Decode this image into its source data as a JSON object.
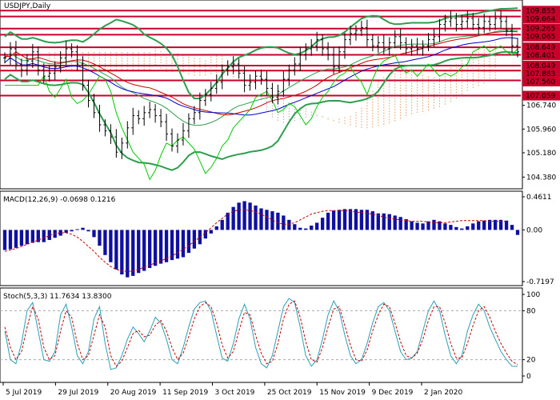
{
  "chart_data": [
    {
      "type": "line",
      "panel": "price",
      "title": "USDJPY,Daily",
      "symbol": "USDJPY",
      "timeframe": "Daily",
      "ylim": [
        104.1,
        110.1
      ],
      "y_ticks": [
        "109.855",
        "109.664",
        "109.265",
        "109.065",
        "108.649",
        "108.401",
        "108.049",
        "107.883",
        "107.560",
        "107.059",
        "106.740",
        "105.960",
        "105.180",
        "104.380"
      ],
      "x_ticks": [
        "5 Jul 2019",
        "29 Jul 2019",
        "20 Aug 2019",
        "11 Sep 2019",
        "3 Oct 2019",
        "25 Oct 2019",
        "15 Nov 2019",
        "9 Dec 2019",
        "2 Jan 2020"
      ],
      "levels": [
        {
          "value": 109.855,
          "label": "109.855"
        },
        {
          "value": 109.664,
          "label": "109.664"
        },
        {
          "value": 109.265,
          "label": "109.265"
        },
        {
          "value": 109.065,
          "label": "109.065"
        },
        {
          "value": 108.649,
          "label": "108.649"
        },
        {
          "value": 108.401,
          "label": "108.401"
        },
        {
          "value": 108.049,
          "label": "108.049"
        },
        {
          "value": 107.883,
          "label": "107.883"
        },
        {
          "value": 107.56,
          "label": "107.560"
        },
        {
          "value": 107.059,
          "label": "107.059"
        }
      ],
      "colors": {
        "level": "#c8002a",
        "bollinger": "#2e9e4e",
        "red_line": "#cc0000",
        "blue_line": "#0000cc",
        "green_line": "#00cc00",
        "cloud_up": "#e07020",
        "cloud_down": "#9a7ab0"
      },
      "close": [
        108.3,
        108.6,
        108.1,
        107.9,
        108.2,
        108.5,
        107.9,
        107.7,
        107.8,
        108.0,
        108.3,
        108.6,
        108.5,
        108.1,
        107.4,
        106.9,
        106.5,
        106.1,
        105.9,
        105.7,
        105.2,
        105.5,
        106.0,
        106.4,
        106.3,
        106.5,
        106.6,
        106.4,
        106.2,
        105.8,
        105.4,
        105.6,
        105.9,
        106.3,
        106.5,
        106.9,
        107.1,
        107.3,
        107.5,
        107.9,
        108.0,
        108.1,
        107.8,
        107.4,
        107.5,
        107.7,
        107.6,
        107.3,
        107.0,
        107.2,
        107.6,
        107.9,
        108.1,
        108.4,
        108.6,
        108.7,
        108.9,
        108.6,
        108.4,
        108.0,
        108.5,
        108.9,
        109.1,
        109.2,
        109.3,
        108.9,
        108.7,
        108.8,
        108.6,
        108.8,
        109.0,
        108.8,
        108.6,
        108.7,
        108.6,
        108.7,
        108.9,
        109.0,
        109.4,
        109.5,
        109.6,
        109.4,
        109.5,
        109.6,
        109.4,
        109.3,
        109.5,
        109.4,
        109.6,
        109.5,
        109.2,
        108.7,
        108.5
      ],
      "series": [
        {
          "name": "Bollinger Bands",
          "role": "envelope"
        },
        {
          "name": "Ichimoku",
          "role": "cloud"
        }
      ]
    },
    {
      "type": "bar",
      "panel": "macd",
      "label": "MACD(12,26,9) -0.0698 0.1216",
      "ylim": [
        -0.7197,
        0.4611
      ],
      "y_ticks": [
        "0.4611",
        "0.00",
        "-0.7197"
      ],
      "histogram": [
        -0.28,
        -0.27,
        -0.25,
        -0.22,
        -0.2,
        -0.18,
        -0.17,
        -0.17,
        -0.14,
        -0.11,
        -0.08,
        -0.04,
        -0.02,
        0.01,
        0.03,
        -0.02,
        -0.1,
        -0.22,
        -0.35,
        -0.45,
        -0.55,
        -0.62,
        -0.66,
        -0.64,
        -0.6,
        -0.57,
        -0.53,
        -0.5,
        -0.47,
        -0.45,
        -0.42,
        -0.4,
        -0.38,
        -0.32,
        -0.26,
        -0.2,
        -0.12,
        -0.05,
        0.05,
        0.14,
        0.24,
        0.32,
        0.38,
        0.4,
        0.38,
        0.34,
        0.3,
        0.28,
        0.26,
        0.24,
        0.2,
        0.14,
        0.08,
        0.03,
        0.02,
        0.06,
        0.1,
        0.17,
        0.24,
        0.27,
        0.28,
        0.29,
        0.29,
        0.29,
        0.28,
        0.28,
        0.26,
        0.23,
        0.23,
        0.22,
        0.2,
        0.18,
        0.15,
        0.12,
        0.1,
        0.09,
        0.12,
        0.14,
        0.12,
        0.09,
        0.07,
        0.04,
        0.02,
        0.05,
        0.09,
        0.12,
        0.13,
        0.14,
        0.14,
        0.14,
        0.13,
        0.07,
        -0.07
      ],
      "signal": [
        -0.3,
        -0.28,
        -0.26,
        -0.23,
        -0.2,
        -0.17,
        -0.14,
        -0.11,
        -0.08,
        -0.05,
        -0.04,
        -0.04,
        -0.06,
        -0.1,
        -0.16,
        -0.23,
        -0.3,
        -0.38,
        -0.45,
        -0.51,
        -0.55,
        -0.57,
        -0.58,
        -0.57,
        -0.55,
        -0.52,
        -0.49,
        -0.46,
        -0.43,
        -0.4,
        -0.36,
        -0.32,
        -0.27,
        -0.22,
        -0.16,
        -0.1,
        -0.04,
        0.03,
        0.1,
        0.16,
        0.22,
        0.26,
        0.28,
        0.28,
        0.27,
        0.25,
        0.22,
        0.18,
        0.14,
        0.1,
        0.08,
        0.08,
        0.1,
        0.14,
        0.18,
        0.22,
        0.24,
        0.26,
        0.27,
        0.27,
        0.27,
        0.27,
        0.26,
        0.25,
        0.24,
        0.23,
        0.22,
        0.2,
        0.18,
        0.16,
        0.15,
        0.14,
        0.13,
        0.12,
        0.12,
        0.12,
        0.11,
        0.1,
        0.1,
        0.1,
        0.11,
        0.12,
        0.13,
        0.13,
        0.13,
        0.13,
        0.13,
        0.12,
        0.12,
        0.12,
        0.12
      ]
    },
    {
      "type": "line",
      "panel": "stochastic",
      "label": "Stoch(5,3,3) 11.7634 13.8300",
      "ylim": [
        0,
        100
      ],
      "y_ticks": [
        "100",
        "80",
        "20",
        "0"
      ],
      "levels": [
        80,
        20
      ],
      "main": [
        55,
        20,
        15,
        40,
        80,
        90,
        55,
        20,
        18,
        30,
        75,
        88,
        60,
        25,
        15,
        30,
        70,
        85,
        40,
        8,
        10,
        25,
        45,
        60,
        52,
        42,
        55,
        72,
        65,
        45,
        20,
        15,
        35,
        60,
        82,
        90,
        92,
        80,
        50,
        22,
        18,
        40,
        70,
        88,
        70,
        35,
        15,
        10,
        25,
        55,
        85,
        95,
        90,
        60,
        25,
        12,
        20,
        45,
        75,
        92,
        80,
        50,
        25,
        15,
        20,
        40,
        65,
        85,
        90,
        80,
        55,
        30,
        20,
        22,
        30,
        55,
        80,
        92,
        80,
        50,
        25,
        15,
        25,
        55,
        75,
        88,
        80,
        60,
        45,
        30,
        20,
        12,
        11.76
      ],
      "signal": [
        60,
        35,
        20,
        30,
        60,
        85,
        70,
        35,
        20,
        25,
        55,
        80,
        72,
        40,
        20,
        25,
        50,
        75,
        60,
        25,
        12,
        18,
        35,
        52,
        56,
        48,
        50,
        62,
        68,
        55,
        35,
        20,
        28,
        48,
        70,
        85,
        90,
        85,
        65,
        38,
        22,
        30,
        55,
        78,
        75,
        50,
        28,
        15,
        18,
        40,
        70,
        88,
        92,
        72,
        42,
        20,
        17,
        35,
        60,
        82,
        85,
        62,
        38,
        20,
        18,
        32,
        55,
        75,
        88,
        85,
        65,
        42,
        25,
        22,
        28,
        45,
        68,
        85,
        85,
        65,
        40,
        22,
        22,
        40,
        62,
        80,
        85,
        72,
        55,
        40,
        28,
        18,
        13.83
      ]
    }
  ]
}
